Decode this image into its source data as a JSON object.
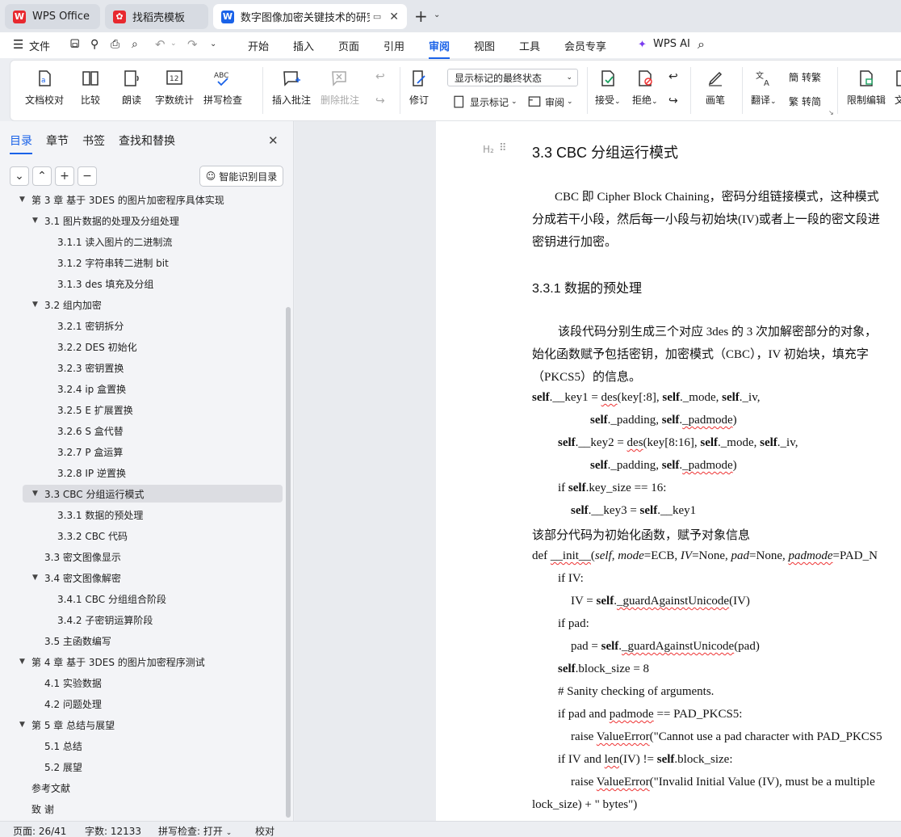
{
  "tabs": [
    {
      "label": "WPS Office"
    },
    {
      "label": "找稻壳模板"
    },
    {
      "label": "数字图像加密关键技术的研究"
    }
  ],
  "new_tab": "+",
  "menu": {
    "file": "文件",
    "items": [
      "开始",
      "插入",
      "页面",
      "引用",
      "审阅",
      "视图",
      "工具",
      "会员专享"
    ],
    "ai": "WPS AI"
  },
  "ribbon": {
    "proof": "文档校对",
    "compare": "比较",
    "read": "朗读",
    "wordcount": "字数统计",
    "spell": "拼写检查",
    "insert_comment": "插入批注",
    "delete_comment": "删除批注",
    "markup_select": "显示标记的最终状态",
    "revise": "修订",
    "show_markup": "显示标记",
    "review": "审阅",
    "accept": "接受",
    "reject": "拒绝",
    "pen": "画笔",
    "translate": "翻译",
    "to_trad": "转繁",
    "to_simp": "转简",
    "restrict": "限制编辑",
    "cut": "文"
  },
  "sidebar": {
    "tabs": [
      "目录",
      "章节",
      "书签",
      "查找和替换"
    ],
    "smart": "智能识别目录",
    "toc": [
      "第 3 章 基于 3DES 的图片加密程序具体实现",
      "3.1 图片数据的处理及分组处理",
      "3.1.1 读入图片的二进制流",
      "3.1.2 字符串转二进制 bit",
      "3.1.3 des 填充及分组",
      "3.2 组内加密",
      "3.2.1 密钥拆分",
      "3.2.2 DES 初始化",
      "3.2.3 密钥置换",
      "3.2.4 ip 盒置换",
      "3.2.5 E 扩展置换",
      "3.2.6 S 盒代替",
      "3.2.7 P 盒运算",
      "3.2.8 IP 逆置换",
      "3.3 CBC 分组运行模式",
      "3.3.1 数据的预处理",
      "3.3.2 CBC 代码",
      "3.3 密文图像显示",
      "3.4 密文图像解密",
      "3.4.1 CBC 分组组合阶段",
      "3.4.2 子密钥运算阶段",
      "3.5 主函数编写",
      "第 4 章 基于 3DES 的图片加密程序测试",
      "4.1 实验数据",
      "4.2 问题处理",
      "第 5 章 总结与展望",
      "5.1 总结",
      "5.2 展望",
      "参考文献",
      "致 谢"
    ]
  },
  "doc": {
    "heading_marker": "H₂",
    "h2": "3.3 CBC 分组运行模式",
    "p1": [
      "CBC 即 Cipher Block Chaining，密码分组链接模式，这种模式",
      "分成若干小段，然后每一小段与初始块(IV)或者上一段的密文段进",
      "密钥进行加密。"
    ],
    "h3": "3.3.1  数据的预处理",
    "p2": [
      "该段代码分别生成三个对应 3des 的 3 次加解密部分的对象，",
      "始化函数赋予包括密钥，加密模式（CBC），IV 初始块，填充字",
      "（PKCS5）的信息。"
    ],
    "code": {
      "l1a": "self",
      "l1b": ".__key1 = ",
      "l1c": "des",
      "l1d": "(key[:8], ",
      "l1e": "self",
      "l1f": "._mode, ",
      "l1g": "self",
      "l1h": "._iv,",
      "l2a": "self",
      "l2b": "._padding, ",
      "l2c": "self",
      "l2d": ".",
      "l2e": "_padmode",
      "l3a": "self",
      "l3b": ".__key2 = ",
      "l3c": "des",
      "l3d": "(key[8:16], ",
      "l3e": "self",
      "l3f": "._mode, ",
      "l3g": "self",
      "l3h": "._iv,",
      "l4a": "self",
      "l4b": "._padding, ",
      "l4c": "self",
      "l4d": ".",
      "l4e": "_padmode",
      "l5a": "if ",
      "l5b": "self",
      "l5c": ".key_size == 16:",
      "l6a": "self",
      "l6b": ".__key3 = ",
      "l6c": "self",
      "l6d": ".__key1",
      "l7": "该部分代码为初始化函数，赋予对象信息",
      "l8a": "def ",
      "l8b": "__init__",
      "l8c": "(",
      "l8d": "self",
      "l8e": ", ",
      "l8f": "mode",
      "l8g": "=ECB, ",
      "l8h": "IV",
      "l8i": "=None, ",
      "l8j": "pad",
      "l8k": "=None, ",
      "l8l": "padmode",
      "l8m": "=PAD_N",
      "l9": "if IV:",
      "l10a": "IV = ",
      "l10b": "self",
      "l10c": ".",
      "l10d": "_guardAgainstUnicode",
      "l10e": "(IV)",
      "l11": "if pad:",
      "l12a": "pad = ",
      "l12b": "self",
      "l12c": ".",
      "l12d": "_guardAgainstUnicode",
      "l12e": "(pad)",
      "l13a": "self",
      "l13b": ".block_size = 8",
      "l14": "# Sanity checking of arguments.",
      "l15a": "if pad and ",
      "l15b": "padmode",
      "l15c": " == PAD_PKCS5:",
      "l16a": "raise ",
      "l16b": "ValueError",
      "l16c": "(\"Cannot use a pad character with PAD_PKCS5",
      "l17a": "if IV and ",
      "l17b": "len",
      "l17c": "(IV) != ",
      "l17d": "self",
      "l17e": ".block_size:",
      "l18a": "raise ",
      "l18b": "ValueError",
      "l18c": "(\"Invalid Initial Value (IV), must be a multiple",
      "l19": "lock_size) + \" bytes\")"
    }
  },
  "status": {
    "page": "页面: 26/41",
    "words": "字数: 12133",
    "spell": "拼写检查: 打开",
    "proof": "校对"
  }
}
